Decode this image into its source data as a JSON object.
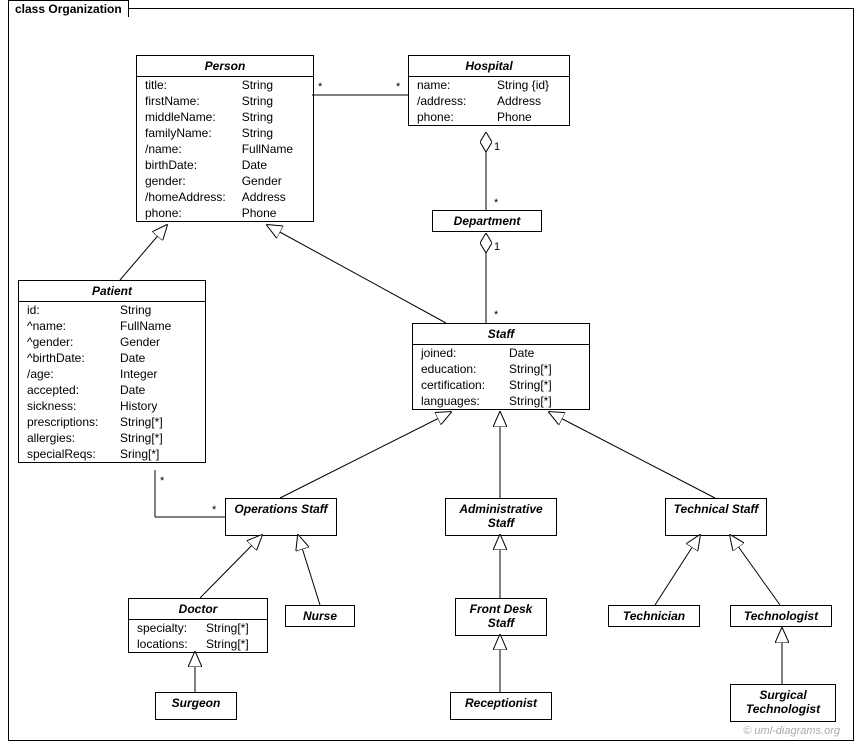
{
  "packageTitle": "class Organization",
  "classes": {
    "person": {
      "name": "Person",
      "attrs": [
        [
          "title:",
          "String"
        ],
        [
          "firstName:",
          "String"
        ],
        [
          "middleName:",
          "String"
        ],
        [
          "familyName:",
          "String"
        ],
        [
          "/name:",
          "FullName"
        ],
        [
          "birthDate:",
          "Date"
        ],
        [
          "gender:",
          "Gender"
        ],
        [
          "/homeAddress:",
          "Address"
        ],
        [
          "phone:",
          "Phone"
        ]
      ]
    },
    "hospital": {
      "name": "Hospital",
      "attrs": [
        [
          "name:",
          "String {id}"
        ],
        [
          "/address:",
          "Address"
        ],
        [
          "phone:",
          "Phone"
        ]
      ]
    },
    "department": {
      "name": "Department"
    },
    "patient": {
      "name": "Patient",
      "attrs": [
        [
          "id:",
          "String"
        ],
        [
          "^name:",
          "FullName"
        ],
        [
          "^gender:",
          "Gender"
        ],
        [
          "^birthDate:",
          "Date"
        ],
        [
          "/age:",
          "Integer"
        ],
        [
          "accepted:",
          "Date"
        ],
        [
          "sickness:",
          "History"
        ],
        [
          "prescriptions:",
          "String[*]"
        ],
        [
          "allergies:",
          "String[*]"
        ],
        [
          "specialReqs:",
          "Sring[*]"
        ]
      ]
    },
    "staff": {
      "name": "Staff",
      "attrs": [
        [
          "joined:",
          "Date"
        ],
        [
          "education:",
          "String[*]"
        ],
        [
          "certification:",
          "String[*]"
        ],
        [
          "languages:",
          "String[*]"
        ]
      ]
    },
    "opsStaff": {
      "name": "Operations Staff"
    },
    "adminStaff": {
      "name": "Administrative Staff"
    },
    "techStaff": {
      "name": "Technical Staff"
    },
    "doctor": {
      "name": "Doctor",
      "attrs": [
        [
          "specialty:",
          "String[*]"
        ],
        [
          "locations:",
          "String[*]"
        ]
      ]
    },
    "nurse": {
      "name": "Nurse"
    },
    "frontDesk": {
      "name": "Front Desk Staff"
    },
    "receptionist": {
      "name": "Receptionist"
    },
    "technician": {
      "name": "Technician"
    },
    "technologist": {
      "name": "Technologist"
    },
    "surgeon": {
      "name": "Surgeon"
    },
    "surgTech": {
      "name": "Surgical Technologist"
    }
  },
  "mult": {
    "star": "*",
    "one": "1"
  },
  "watermark": "© uml-diagrams.org"
}
